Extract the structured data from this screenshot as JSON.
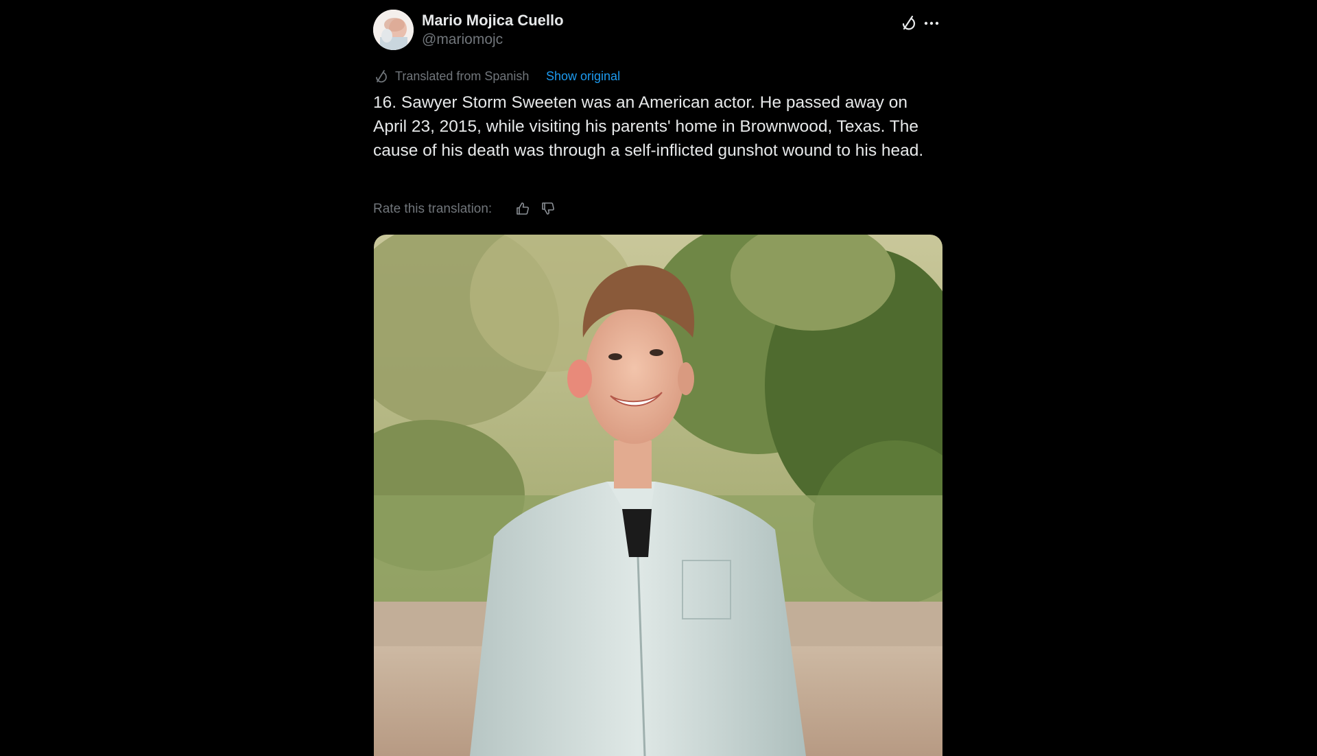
{
  "tweet": {
    "author": {
      "display_name": "Mario Mojica Cuello",
      "handle": "@mariomojc"
    },
    "header_icons": {
      "grok": "grok-icon",
      "more": "more-horizontal-icon"
    },
    "translation": {
      "icon": "translate-icon",
      "label": "Translated from Spanish",
      "show_original": "Show original"
    },
    "text": "16. Sawyer Storm Sweeten was an American actor. He passed away on April 23, 2015, while visiting his parents' home in Brownwood, Texas. The cause of his death was through a self-inflicted gunshot wound to his head.",
    "rating": {
      "label": "Rate this translation:",
      "thumbs_up": "thumbs-up-icon",
      "thumbs_down": "thumbs-down-icon"
    },
    "media": {
      "type": "photo"
    }
  },
  "colors": {
    "background": "#000000",
    "primary_text": "#e7e9ea",
    "secondary_text": "#71767b",
    "link": "#1d9bf0"
  }
}
